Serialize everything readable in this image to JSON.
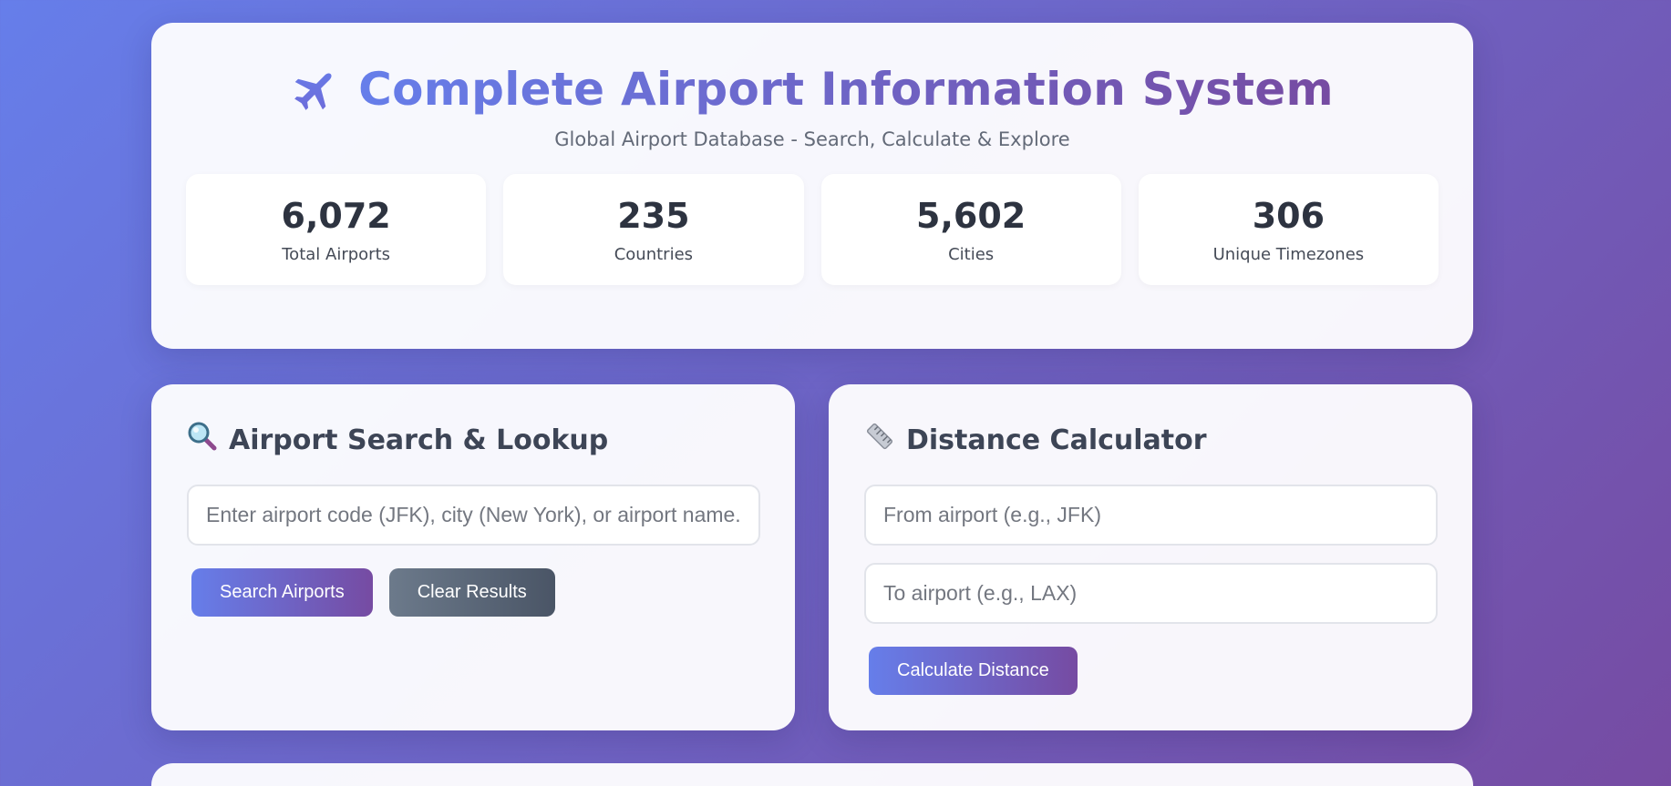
{
  "header": {
    "title": "Complete Airport Information System",
    "subtitle": "Global Airport Database - Search, Calculate & Explore",
    "plane_icon": "airplane-icon"
  },
  "stats": [
    {
      "value": "6,072",
      "label": "Total Airports"
    },
    {
      "value": "235",
      "label": "Countries"
    },
    {
      "value": "5,602",
      "label": "Cities"
    },
    {
      "value": "306",
      "label": "Unique Timezones"
    }
  ],
  "search_panel": {
    "icon": "magnifying-glass-icon",
    "title": "Airport Search & Lookup",
    "input_placeholder": "Enter airport code (JFK), city (New York), or airport name...",
    "input_value": "",
    "search_button": "Search Airports",
    "clear_button": "Clear Results"
  },
  "distance_panel": {
    "icon": "ruler-icon",
    "title": "Distance Calculator",
    "from_placeholder": "From airport (e.g., JFK)",
    "to_placeholder": "To airport (e.g., LAX)",
    "calculate_button": "Calculate Distance"
  },
  "colors": {
    "gradient_start": "#667eea",
    "gradient_end": "#764ba2",
    "secondary_button": "#5a6677"
  }
}
